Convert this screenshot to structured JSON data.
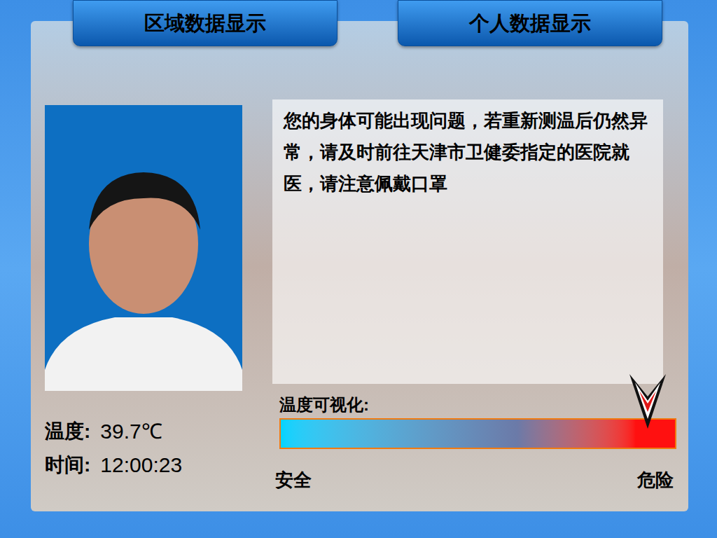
{
  "tabs": [
    {
      "label": "区域数据显示",
      "selected": false
    },
    {
      "label": "个人数据显示",
      "selected": false
    }
  ],
  "message": "您的身体可能出现问题，若重新测温后仍然异常，请及时前往天津市卫健委指定的医院就医，请注意佩戴口罩",
  "temperature": {
    "label": "温度:",
    "value": "39.7℃"
  },
  "time": {
    "label": "时间:",
    "value": "12:00:23"
  },
  "visualization": {
    "label": "温度可视化:",
    "level": 0.93,
    "min_label": "安全",
    "max_label": "危险"
  }
}
